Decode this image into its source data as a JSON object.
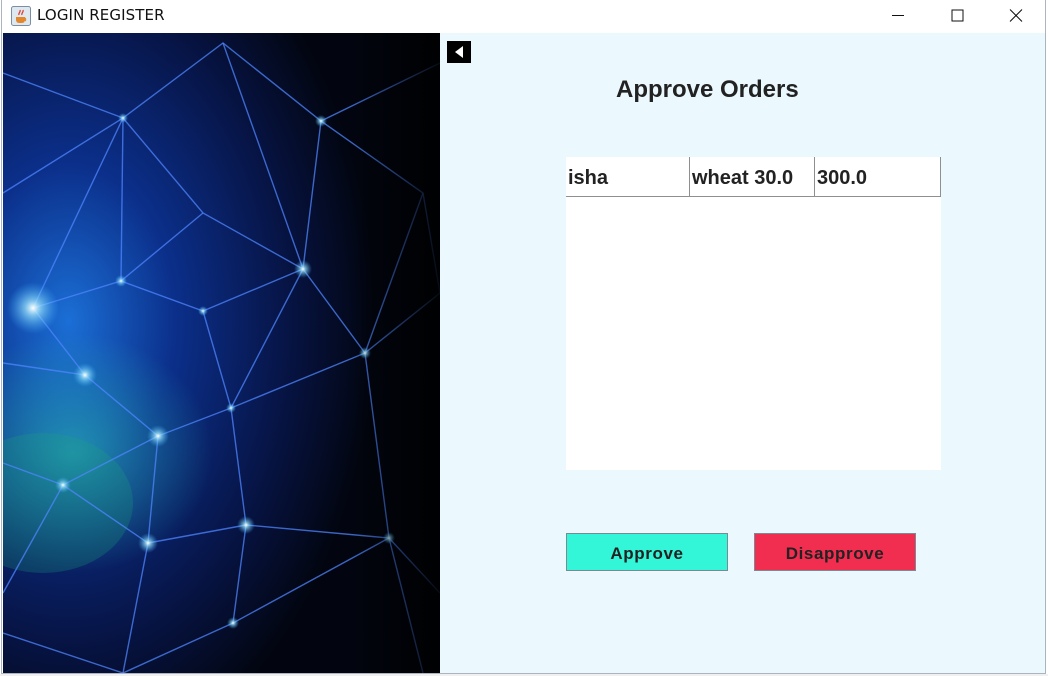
{
  "window": {
    "title": "LOGIN REGISTER",
    "controls": [
      "minimize",
      "maximize",
      "close"
    ]
  },
  "icons": {
    "app": "java-cup-icon",
    "back": "back-arrow-icon",
    "minimize": "minimize-icon",
    "maximize": "maximize-icon",
    "close": "close-icon"
  },
  "left_panel": {
    "image": "abstract-blue-network-image"
  },
  "main": {
    "title": "Approve Orders",
    "orders": [
      {
        "name": "isha",
        "item": "wheat 30.0",
        "amount": "300.0"
      }
    ],
    "approve_label": "Approve",
    "disapprove_label": "Disapprove"
  },
  "colors": {
    "panel_bg": "#ebf9fe",
    "approve": "#33f5d8",
    "disapprove": "#f22e50"
  }
}
